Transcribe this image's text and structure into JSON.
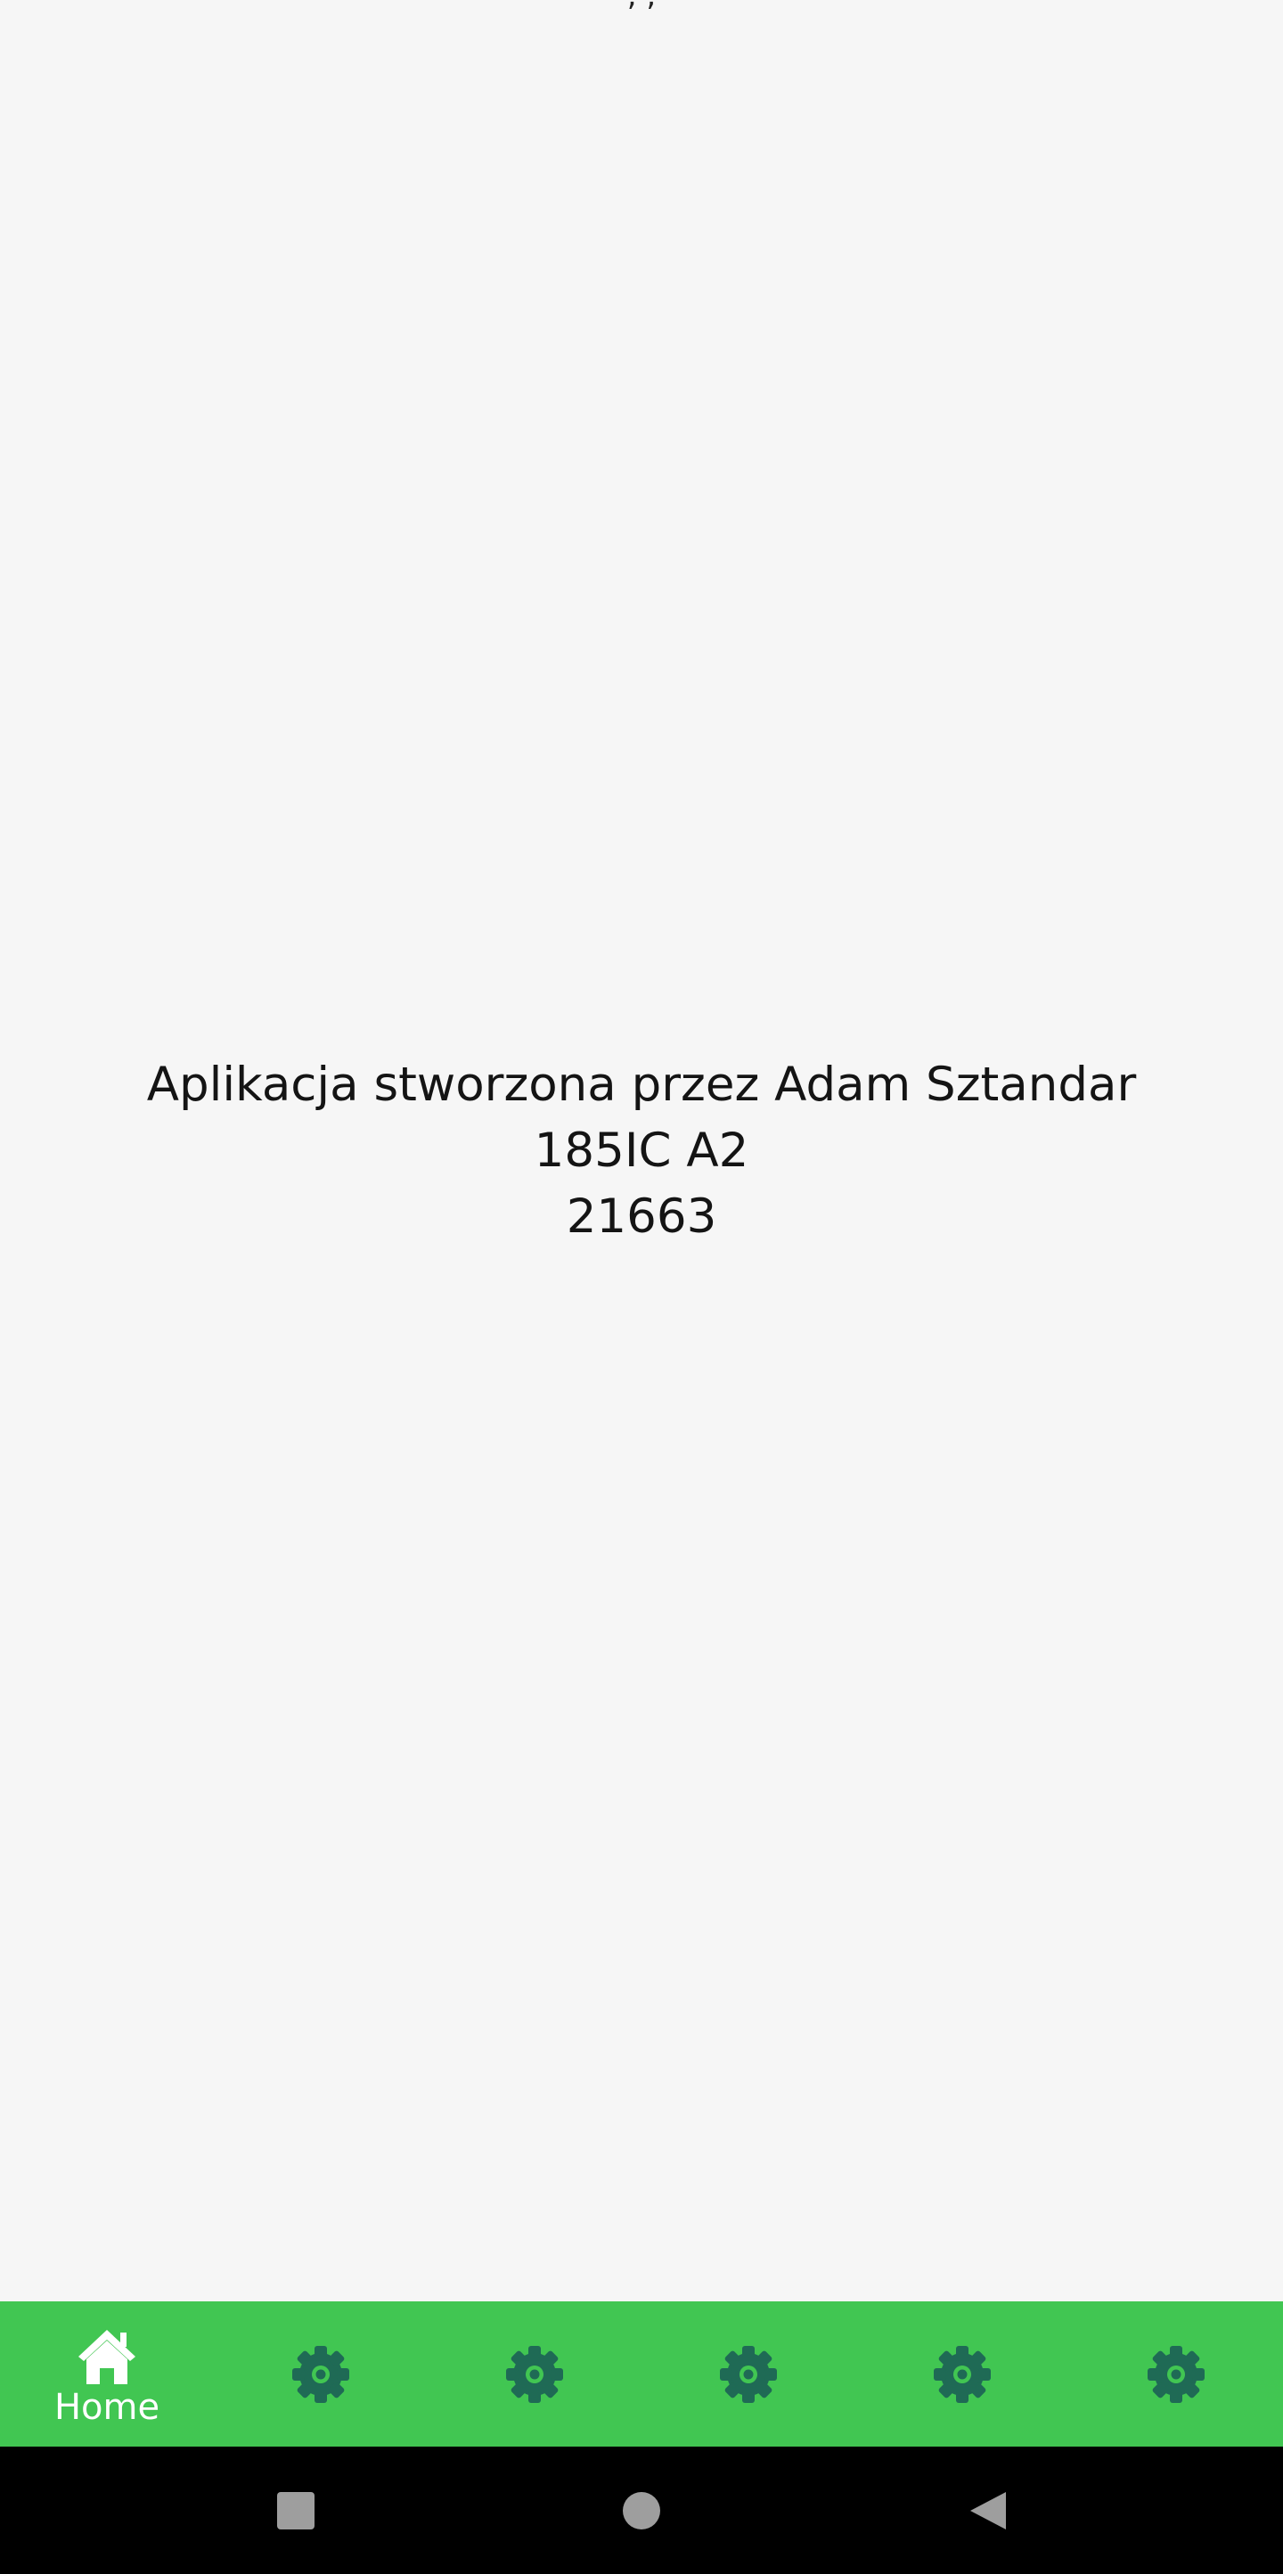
{
  "status_bar": {
    "partial_text": ",  ,"
  },
  "main": {
    "credit_lines": [
      "Aplikacja stworzona przez Adam Sztandar",
      "185IC A2",
      "21663"
    ]
  },
  "bottom_nav": {
    "background": "#41c652",
    "items": [
      {
        "label": "Home",
        "icon": "home-icon"
      },
      {
        "label": "",
        "icon": "gear-icon"
      },
      {
        "label": "",
        "icon": "gear-icon"
      },
      {
        "label": "",
        "icon": "gear-icon"
      },
      {
        "label": "",
        "icon": "gear-icon"
      },
      {
        "label": "",
        "icon": "gear-icon"
      }
    ]
  },
  "system_nav": {
    "buttons": [
      "recents-square-icon",
      "home-circle-icon",
      "back-triangle-icon"
    ]
  },
  "colors": {
    "page_background": "#f6f6f6",
    "nav_accent": "#41c652",
    "gear_icon": "#1f6a55",
    "system_bar": "#000000",
    "system_icons": "#9e9e9e"
  }
}
